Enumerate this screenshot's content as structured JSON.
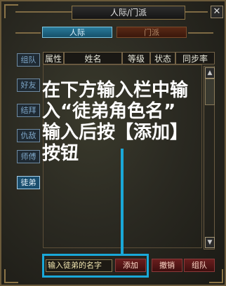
{
  "window": {
    "title": "人际/门派",
    "close_symbol": "✕"
  },
  "tabs": [
    {
      "label": "人际",
      "active": true
    },
    {
      "label": "门派",
      "active": false
    }
  ],
  "sidebar": {
    "items": [
      {
        "label": "组队",
        "selected": false
      },
      {
        "label": "好友",
        "selected": false
      },
      {
        "label": "结拜",
        "selected": false
      },
      {
        "label": "仇敌",
        "selected": false
      },
      {
        "label": "师傅",
        "selected": false
      },
      {
        "label": "徒弟",
        "selected": true
      }
    ]
  },
  "table": {
    "headers": [
      "属性",
      "姓名",
      "等级",
      "状态",
      "同步率"
    ],
    "rows": []
  },
  "scrollbar": {
    "up_symbol": "▲",
    "down_symbol": "▼"
  },
  "overlay": {
    "lines": [
      "在下方输入栏中输",
      "入“徒弟角色名”",
      "输入后按【添加】",
      "按钮"
    ],
    "highlight_color": "#1aa8d8"
  },
  "bottom": {
    "input_value": "输入徒弟的名字",
    "add_label": "添加",
    "cancel_label": "撤销",
    "team_label": "组队"
  }
}
